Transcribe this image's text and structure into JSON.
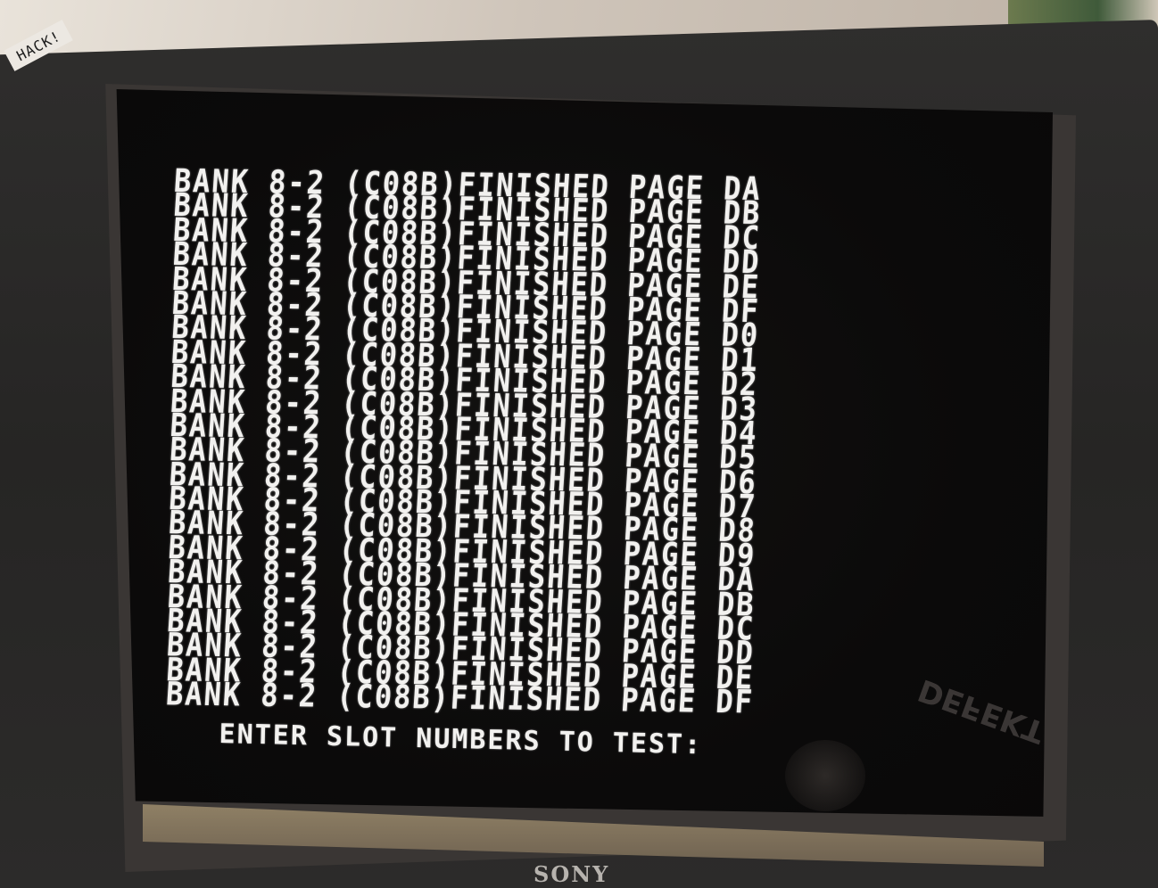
{
  "sticker": {
    "text": "HACK!"
  },
  "terminal": {
    "lines": [
      "BANK 8-2 (C08B)FINISHED PAGE DA",
      "BANK 8-2 (C08B)FINISHED PAGE DB",
      "BANK 8-2 (C08B)FINISHED PAGE DC",
      "BANK 8-2 (C08B)FINISHED PAGE DD",
      "BANK 8-2 (C08B)FINISHED PAGE DE",
      "BANK 8-2 (C08B)FINISHED PAGE DF",
      "BANK 8-2 (C08B)FINISHED PAGE D0",
      "BANK 8-2 (C08B)FINISHED PAGE D1",
      "BANK 8-2 (C08B)FINISHED PAGE D2",
      "BANK 8-2 (C08B)FINISHED PAGE D3",
      "BANK 8-2 (C08B)FINISHED PAGE D4",
      "BANK 8-2 (C08B)FINISHED PAGE D5",
      "BANK 8-2 (C08B)FINISHED PAGE D6",
      "BANK 8-2 (C08B)FINISHED PAGE D7",
      "BANK 8-2 (C08B)FINISHED PAGE D8",
      "BANK 8-2 (C08B)FINISHED PAGE D9",
      "BANK 8-2 (C08B)FINISHED PAGE DA",
      "BANK 8-2 (C08B)FINISHED PAGE DB",
      "BANK 8-2 (C08B)FINISHED PAGE DC",
      "BANK 8-2 (C08B)FINISHED PAGE DD",
      "BANK 8-2 (C08B)FINISHED PAGE DE",
      "BANK 8-2 (C08B)FINISHED PAGE DF"
    ],
    "prompt": "ENTER SLOT NUMBERS TO TEST:"
  },
  "reflection": {
    "text": "DEFEKT"
  },
  "monitor": {
    "brand": "SONY"
  }
}
